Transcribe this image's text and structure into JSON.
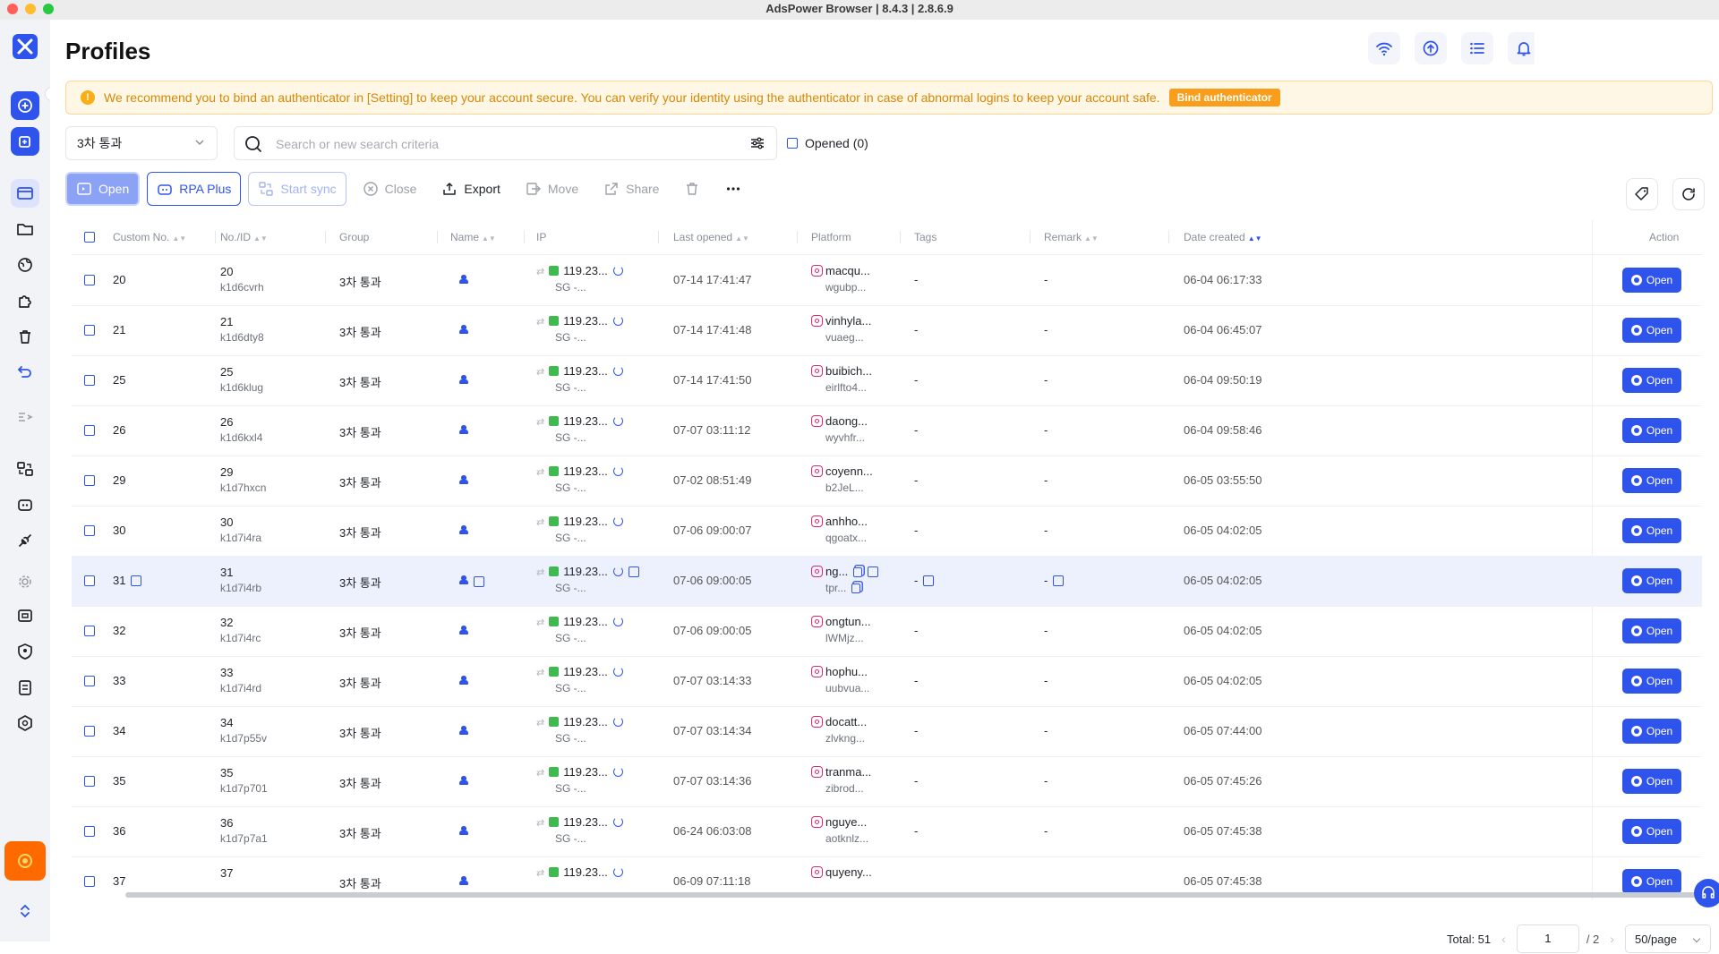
{
  "window": {
    "title": "AdsPower Browser | 8.4.3 | 2.8.6.9"
  },
  "page": {
    "title": "Profiles"
  },
  "notice": {
    "text": "We recommend you to bind an authenticator in [Setting] to keep your account secure. You can verify your identity using the authenticator in case of abnormal logins to keep your account safe.",
    "button": "Bind authenticator"
  },
  "filters": {
    "group_selected": "3차 통과",
    "search_placeholder": "Search or new search criteria",
    "opened_label": "Opened (0)"
  },
  "toolbar": {
    "open": "Open",
    "rpa_plus": "RPA Plus",
    "start_sync": "Start sync",
    "close": "Close",
    "export": "Export",
    "move": "Move",
    "share": "Share"
  },
  "columns": {
    "custom_no": "Custom No.",
    "no_id": "No./ID",
    "group": "Group",
    "name": "Name",
    "ip": "IP",
    "last_opened": "Last opened",
    "platform": "Platform",
    "tags": "Tags",
    "remark": "Remark",
    "date_created": "Date created",
    "action": "Action"
  },
  "rows": [
    {
      "custom": "20",
      "no": "20",
      "id": "k1d6cvrh",
      "group": "3차 통과",
      "ip": "119.23...",
      "ip_loc": "SG -...",
      "last": "07-14 17:41:47",
      "plat1": "macqu...",
      "plat2": "wgubp...",
      "tags": "-",
      "remark": "-",
      "created": "06-04 06:17:33",
      "open": "Open"
    },
    {
      "custom": "21",
      "no": "21",
      "id": "k1d6dty8",
      "group": "3차 통과",
      "ip": "119.23...",
      "ip_loc": "SG -...",
      "last": "07-14 17:41:48",
      "plat1": "vinhyla...",
      "plat2": "vuaeg...",
      "tags": "-",
      "remark": "-",
      "created": "06-04 06:45:07",
      "open": "Open"
    },
    {
      "custom": "25",
      "no": "25",
      "id": "k1d6klug",
      "group": "3차 통과",
      "ip": "119.23...",
      "ip_loc": "SG -...",
      "last": "07-14 17:41:50",
      "plat1": "buibich...",
      "plat2": "eirlfto4...",
      "tags": "-",
      "remark": "-",
      "created": "06-04 09:50:19",
      "open": "Open"
    },
    {
      "custom": "26",
      "no": "26",
      "id": "k1d6kxl4",
      "group": "3차 통과",
      "ip": "119.23...",
      "ip_loc": "SG -...",
      "last": "07-07 03:11:12",
      "plat1": "daong...",
      "plat2": "wyvhfr...",
      "tags": "-",
      "remark": "-",
      "created": "06-04 09:58:46",
      "open": "Open"
    },
    {
      "custom": "29",
      "no": "29",
      "id": "k1d7hxcn",
      "group": "3차 통과",
      "ip": "119.23...",
      "ip_loc": "SG -...",
      "last": "07-02 08:51:49",
      "plat1": "coyenn...",
      "plat2": "b2JeL...",
      "tags": "-",
      "remark": "-",
      "created": "06-05 03:55:50",
      "open": "Open"
    },
    {
      "custom": "30",
      "no": "30",
      "id": "k1d7i4ra",
      "group": "3차 통과",
      "ip": "119.23...",
      "ip_loc": "SG -...",
      "last": "07-06 09:00:07",
      "plat1": "anhho...",
      "plat2": "qgoatx...",
      "tags": "-",
      "remark": "-",
      "created": "06-05 04:02:05",
      "open": "Open"
    },
    {
      "custom": "31",
      "no": "31",
      "id": "k1d7i4rb",
      "group": "3차 통과",
      "ip": "119.23...",
      "ip_loc": "SG -...",
      "last": "07-06 09:00:05",
      "plat1": "ng...",
      "plat2": "tpr...",
      "tags": "-",
      "remark": "-",
      "created": "06-05 04:02:05",
      "open": "Open"
    },
    {
      "custom": "32",
      "no": "32",
      "id": "k1d7i4rc",
      "group": "3차 통과",
      "ip": "119.23...",
      "ip_loc": "SG -...",
      "last": "07-06 09:00:05",
      "plat1": "ongtun...",
      "plat2": "lWMjz...",
      "tags": "-",
      "remark": "-",
      "created": "06-05 04:02:05",
      "open": "Open"
    },
    {
      "custom": "33",
      "no": "33",
      "id": "k1d7i4rd",
      "group": "3차 통과",
      "ip": "119.23...",
      "ip_loc": "SG -...",
      "last": "07-07 03:14:33",
      "plat1": "hophu...",
      "plat2": "uubvua...",
      "tags": "-",
      "remark": "-",
      "created": "06-05 04:02:05",
      "open": "Open"
    },
    {
      "custom": "34",
      "no": "34",
      "id": "k1d7p55v",
      "group": "3차 통과",
      "ip": "119.23...",
      "ip_loc": "SG -...",
      "last": "07-07 03:14:34",
      "plat1": "docatt...",
      "plat2": "zlvkng...",
      "tags": "-",
      "remark": "-",
      "created": "06-05 07:44:00",
      "open": "Open"
    },
    {
      "custom": "35",
      "no": "35",
      "id": "k1d7p701",
      "group": "3차 통과",
      "ip": "119.23...",
      "ip_loc": "SG -...",
      "last": "07-07 03:14:36",
      "plat1": "tranma...",
      "plat2": "zibrod...",
      "tags": "-",
      "remark": "-",
      "created": "06-05 07:45:26",
      "open": "Open"
    },
    {
      "custom": "36",
      "no": "36",
      "id": "k1d7p7a1",
      "group": "3차 통과",
      "ip": "119.23...",
      "ip_loc": "SG -...",
      "last": "06-24 06:03:08",
      "plat1": "nguye...",
      "plat2": "aotknlz...",
      "tags": "-",
      "remark": "-",
      "created": "06-05 07:45:38",
      "open": "Open"
    },
    {
      "custom": "37",
      "no": "37",
      "id": "",
      "group": "3차 통과",
      "ip": "119.23...",
      "ip_loc": "",
      "last": "06-09 07:11:18",
      "plat1": "quyeny...",
      "plat2": "",
      "tags": "",
      "remark": "",
      "created": "06-05 07:45:38",
      "open": "Open"
    }
  ],
  "highlighted_row": 6,
  "pagination": {
    "total": "Total: 51",
    "page": "1",
    "pages": "/ 2",
    "page_size": "50/page"
  },
  "colors": {
    "accent": "#2f54eb",
    "notice_bg": "#fff7e6",
    "notice_button": "#fa9d1a",
    "row_highlight": "#edf1fd"
  }
}
